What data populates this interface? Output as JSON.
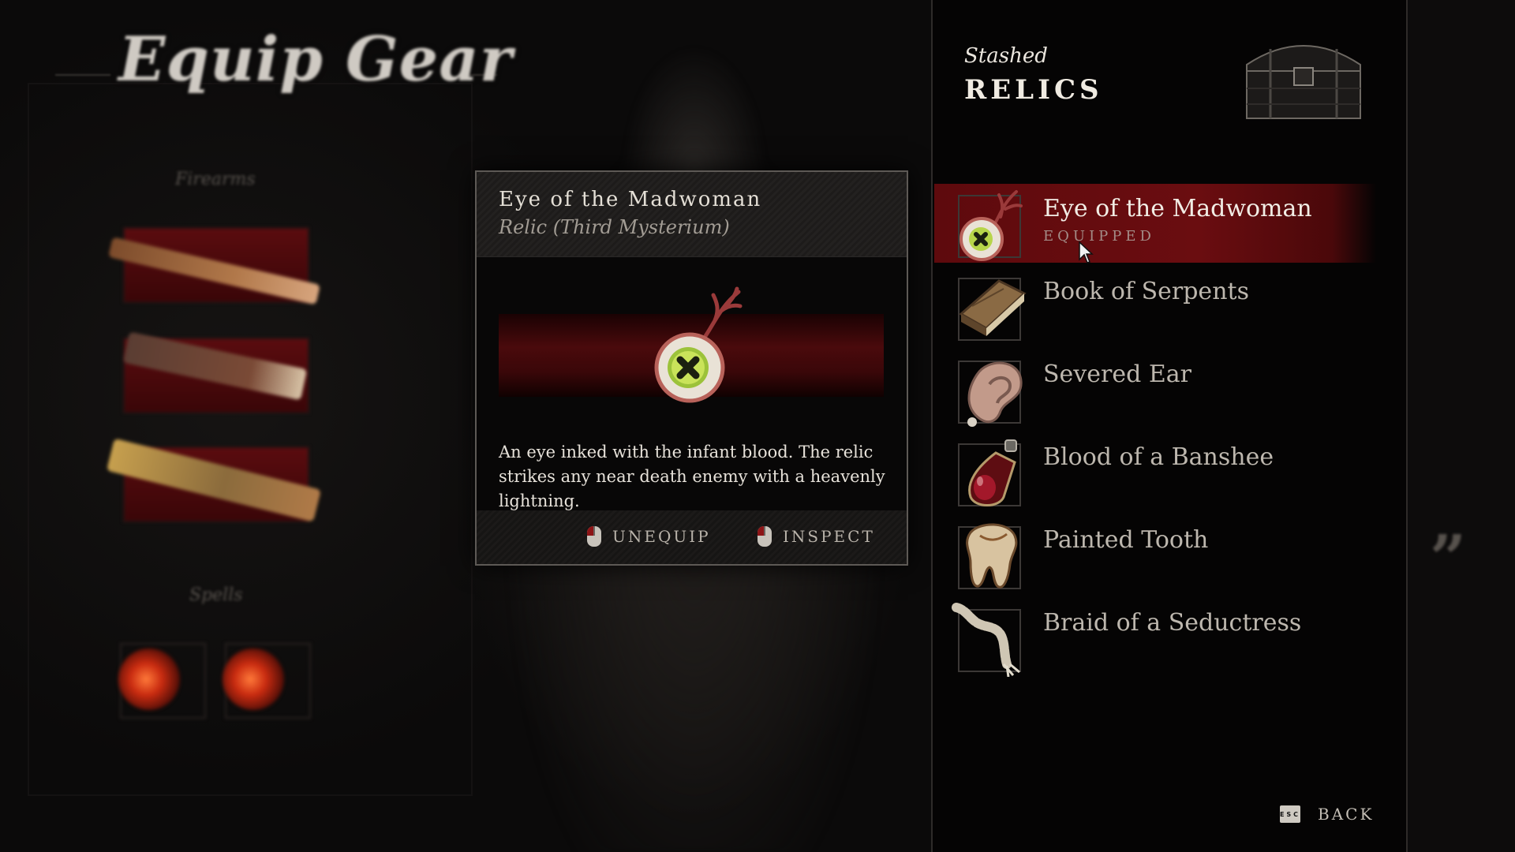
{
  "screen": {
    "title": "Equip Gear",
    "sections": {
      "firearms": "Firearms",
      "spells": "Spells"
    }
  },
  "detail_card": {
    "name": "Eye of the Madwoman",
    "type": "Relic (Third Mysterium)",
    "description": "An eye inked with the infant blood. The relic strikes any near death enemy with a heavenly lightning.",
    "actions": [
      {
        "label": "UNEQUIP",
        "icon": "left-mouse-icon"
      },
      {
        "label": "INSPECT",
        "icon": "right-mouse-icon"
      }
    ]
  },
  "stash": {
    "small_title": "Stashed",
    "big_title": "RELICS",
    "relics": [
      {
        "name": "Eye of the Madwoman",
        "status": "EQUIPPED",
        "icon": "eye-relic-icon"
      },
      {
        "name": "Book of Serpents",
        "icon": "book-relic-icon"
      },
      {
        "name": "Severed Ear",
        "icon": "ear-relic-icon"
      },
      {
        "name": "Blood of a Banshee",
        "icon": "vial-relic-icon"
      },
      {
        "name": "Painted Tooth",
        "icon": "tooth-relic-icon"
      },
      {
        "name": "Braid of a Seductress",
        "icon": "braid-relic-icon"
      }
    ]
  },
  "footer": {
    "back_label": "BACK",
    "esc_key": "ESC"
  },
  "colors": {
    "accent_red": "#6a0d10",
    "text": "#d9d4cc",
    "dim_text": "#bdb7ae",
    "panel_bg": "#050404"
  }
}
